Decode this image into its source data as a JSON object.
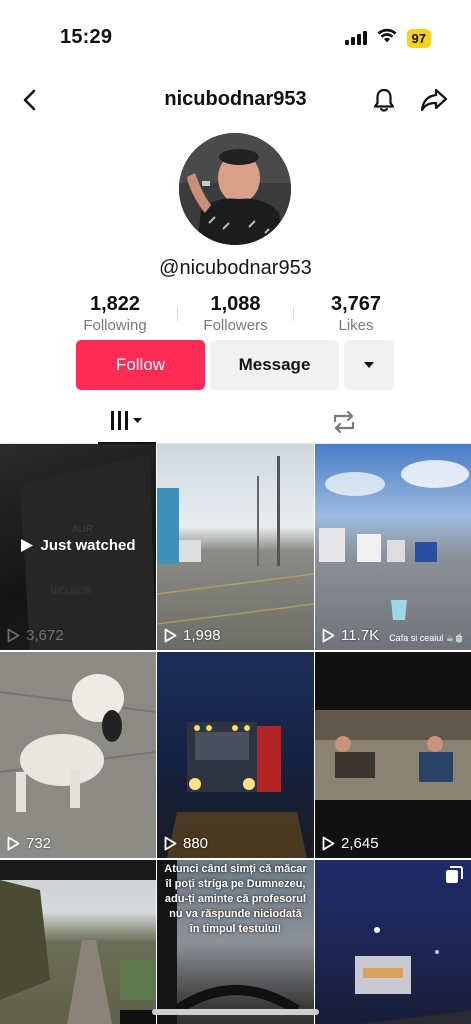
{
  "status_bar": {
    "time": "15:29",
    "battery": "97"
  },
  "header": {
    "username": "nicubodnar953"
  },
  "profile": {
    "handle": "@nicubodnar953",
    "stats": [
      {
        "value": "1,822",
        "label": "Following"
      },
      {
        "value": "1,088",
        "label": "Followers"
      },
      {
        "value": "3,767",
        "label": "Likes"
      }
    ]
  },
  "actions": {
    "follow_label": "Follow",
    "message_label": "Message"
  },
  "tabs": [
    {
      "name": "videos",
      "icon": "grid-icon",
      "active": true
    },
    {
      "name": "reposts",
      "icon": "repost-icon",
      "active": false
    }
  ],
  "videos": [
    {
      "views": "3,672",
      "badge": "Just watched"
    },
    {
      "views": "1,998"
    },
    {
      "views": "11.7K",
      "caption": "Cafa si ceaiul ☕🍵"
    },
    {
      "views": "732"
    },
    {
      "views": "880"
    },
    {
      "views": "2,645"
    },
    {
      "views": ""
    },
    {
      "views": "",
      "overlay_text": "Atunci când simți că măcar îl poți stríga pe Dumnezeu, adu-ți aminte că profesorul nu va răspunde niciodată în timpul testului!"
    },
    {
      "views": ""
    }
  ],
  "colors": {
    "follow": "#fe2c55",
    "battery": "#f7d21a"
  }
}
